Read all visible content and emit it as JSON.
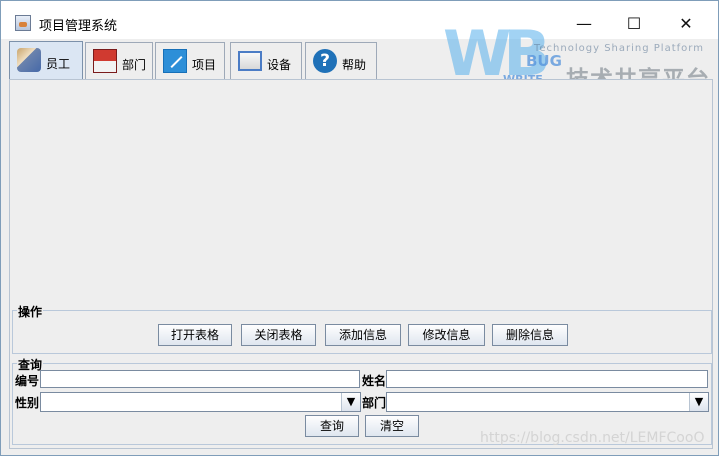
{
  "window": {
    "title": "项目管理系统",
    "controls": [
      "—",
      "☐",
      "✕"
    ]
  },
  "watermark": {
    "letters": "WB",
    "bug": "BUG",
    "write": "WRITE",
    "tagline": "Technology Sharing Platform",
    "cn": "技术共享平台",
    "url": "https://blog.csdn.net/LEMFCooO"
  },
  "tabs": [
    {
      "label": "员工",
      "icon": "staff-icon",
      "selected": true
    },
    {
      "label": "部门",
      "icon": "department-icon",
      "selected": false
    },
    {
      "label": "项目",
      "icon": "project-icon",
      "selected": false
    },
    {
      "label": "设备",
      "icon": "device-icon",
      "selected": false
    },
    {
      "label": "帮助",
      "icon": "help-icon",
      "selected": false
    }
  ],
  "operations": {
    "legend": "操作",
    "buttons": [
      "打开表格",
      "关闭表格",
      "添加信息",
      "修改信息",
      "删除信息"
    ]
  },
  "query": {
    "legend": "查询",
    "fields": {
      "no_label": "编号",
      "name_label": "姓名",
      "sex_label": "性别",
      "dept_label": "部门",
      "no_value": "",
      "name_value": "",
      "sex_value": "",
      "dept_value": ""
    },
    "buttons": {
      "search": "查询",
      "clear": "清空"
    }
  },
  "colors": {
    "tab_selected": "#dbe6f3",
    "panel_bg": "#eeeeee",
    "border": "#7a8ba0",
    "watermark_blue": "#5eb3ec"
  }
}
